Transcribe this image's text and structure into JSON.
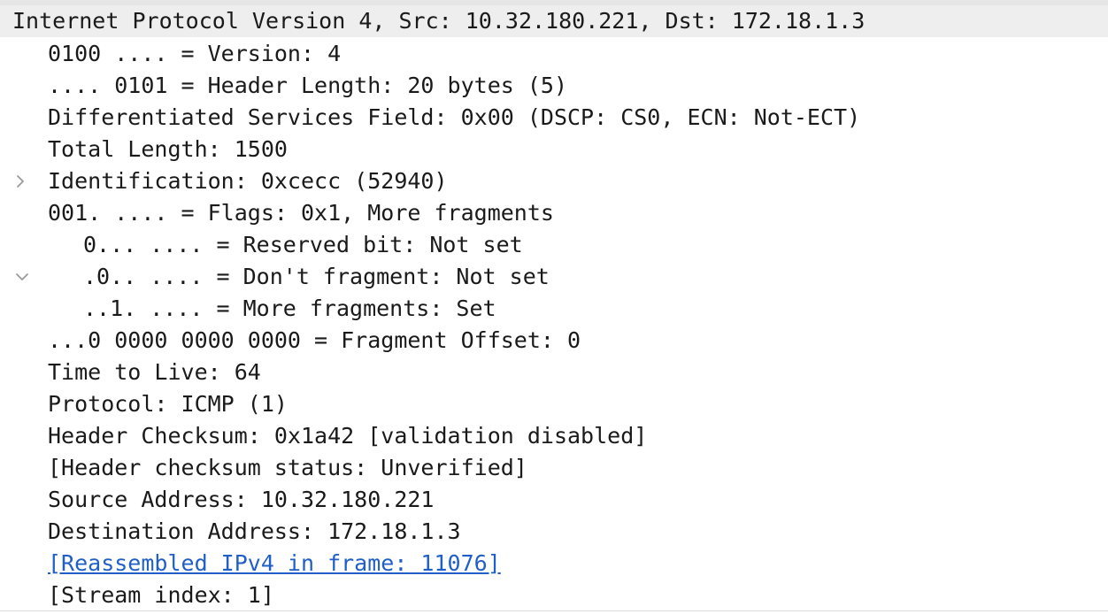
{
  "header": {
    "title": "Internet Protocol Version 4, Src: 10.32.180.221, Dst: 172.18.1.3"
  },
  "fields": {
    "version": "0100 .... = Version: 4",
    "header_length": ".... 0101 = Header Length: 20 bytes (5)",
    "dsfield": "Differentiated Services Field: 0x00 (DSCP: CS0, ECN: Not-ECT)",
    "total_length": "Total Length: 1500",
    "identification": "Identification: 0xcecc (52940)",
    "flags": "001. .... = Flags: 0x1, More fragments",
    "flags_reserved": "0... .... = Reserved bit: Not set",
    "flags_df": ".0.. .... = Don't fragment: Not set",
    "flags_mf": "..1. .... = More fragments: Set",
    "frag_offset": "...0 0000 0000 0000 = Fragment Offset: 0",
    "ttl": "Time to Live: 64",
    "protocol": "Protocol: ICMP (1)",
    "checksum": "Header Checksum: 0x1a42 [validation disabled]",
    "checksum_status": "[Header checksum status: Unverified]",
    "src": "Source Address: 10.32.180.221",
    "dst": "Destination Address: 172.18.1.3",
    "reassembled": "[Reassembled IPv4 in frame: 11076]",
    "stream_index": "[Stream index: 1]"
  },
  "icons": {
    "collapsed": "chevron-right-icon",
    "expanded": "chevron-down-icon"
  },
  "colors": {
    "link": "#1f5fc7",
    "header_bg": "#eeeeee",
    "text": "#1a1a1a",
    "chevron": "#9a9a9a"
  }
}
